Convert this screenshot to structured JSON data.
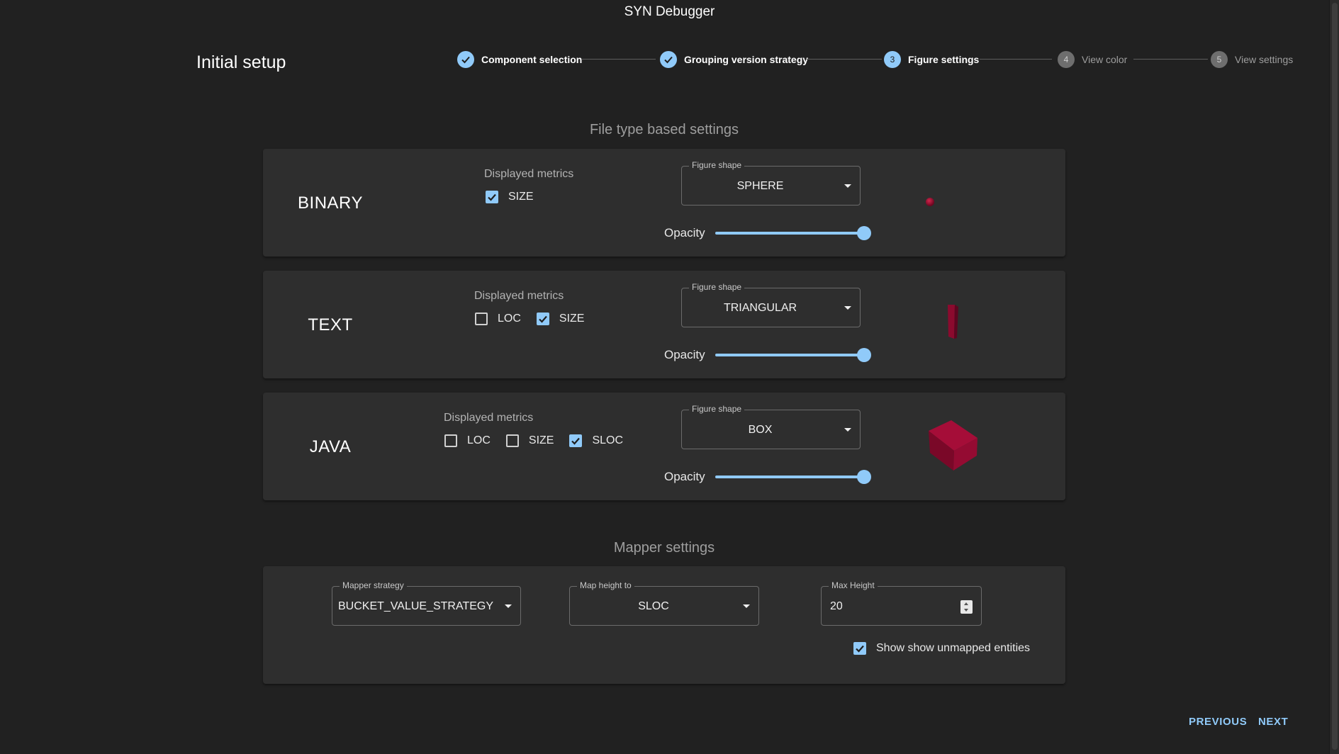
{
  "window": {
    "title": "SYN Debugger"
  },
  "page": {
    "title": "Initial setup"
  },
  "stepper": {
    "steps": [
      {
        "label": "Component selection",
        "status": "done",
        "number": "1"
      },
      {
        "label": "Grouping version strategy",
        "status": "done",
        "number": "2"
      },
      {
        "label": "Figure settings",
        "status": "active",
        "number": "3"
      },
      {
        "label": "View color",
        "status": "todo",
        "number": "4"
      },
      {
        "label": "View settings",
        "status": "todo",
        "number": "5"
      }
    ]
  },
  "file_type_settings": {
    "title": "File type based settings",
    "metrics_label": "Displayed metrics",
    "shape_label": "Figure shape",
    "opacity_label": "Opacity",
    "types": [
      {
        "name": "BINARY",
        "metrics": [
          {
            "label": "SIZE",
            "checked": true
          }
        ],
        "shape": "SPHERE",
        "opacity": 1.0,
        "preview": "sphere-figure"
      },
      {
        "name": "TEXT",
        "metrics": [
          {
            "label": "LOC",
            "checked": false
          },
          {
            "label": "SIZE",
            "checked": true
          }
        ],
        "shape": "TRIANGULAR",
        "opacity": 1.0,
        "preview": "triangular-figure"
      },
      {
        "name": "JAVA",
        "metrics": [
          {
            "label": "LOC",
            "checked": false
          },
          {
            "label": "SIZE",
            "checked": false
          },
          {
            "label": "SLOC",
            "checked": true
          }
        ],
        "shape": "BOX",
        "opacity": 1.0,
        "preview": "box-figure"
      }
    ]
  },
  "mapper_settings": {
    "title": "Mapper settings",
    "strategy": {
      "label": "Mapper strategy",
      "value": "BUCKET_VALUE_STRATEGY"
    },
    "map_height_to": {
      "label": "Map height to",
      "value": "SLOC"
    },
    "max_height": {
      "label": "Max Height",
      "value": "20"
    },
    "show_unmapped": {
      "label": "Show show unmapped entities",
      "checked": true
    }
  },
  "footer": {
    "previous_label": "PREVIOUS",
    "next_label": "NEXT"
  },
  "colors": {
    "accent": "#90caf9",
    "figure": "#8b0a2e",
    "background": "#212121",
    "card": "#2e2e2e"
  }
}
